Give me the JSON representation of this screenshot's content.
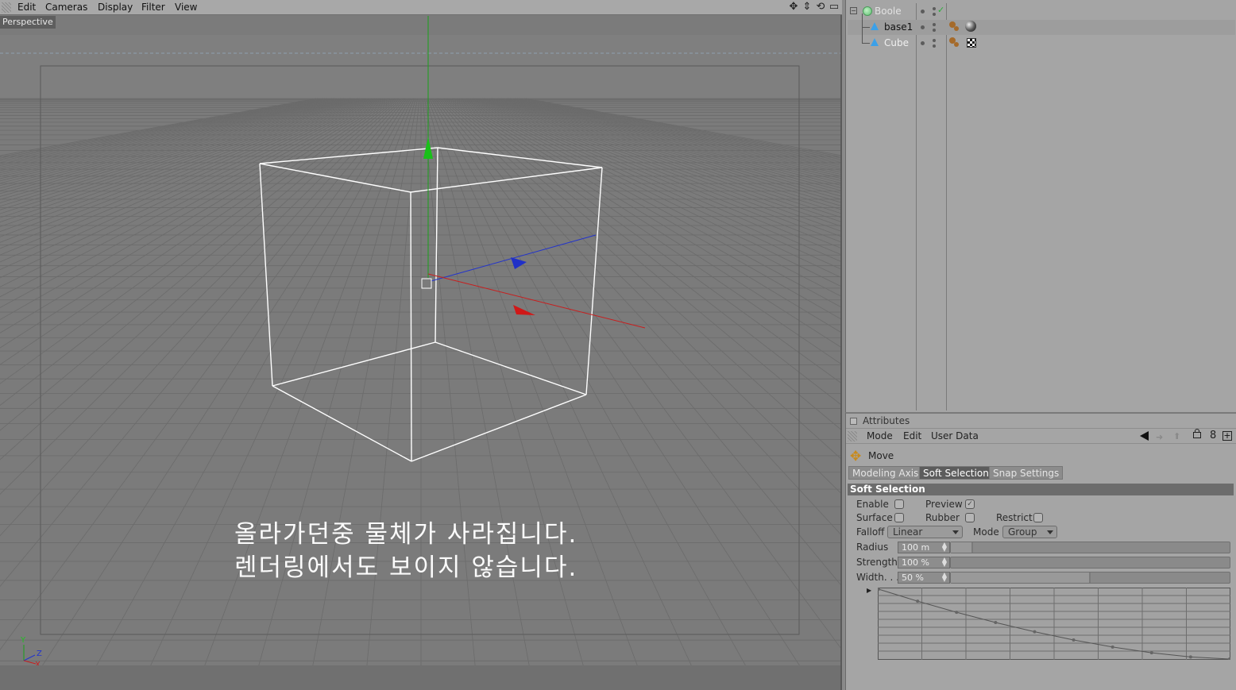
{
  "viewport": {
    "menu": [
      "Edit",
      "Cameras",
      "Display",
      "Filter",
      "View"
    ],
    "camera_label": "Perspective",
    "nav_icons": [
      "move-view-icon",
      "dolly-view-icon",
      "rotate-view-icon",
      "maximize-view-icon"
    ],
    "axis_labels": {
      "y": "Y",
      "z": "Z",
      "x": "X"
    },
    "caption_line1": "올라가던중 물체가 사라집니다.",
    "caption_line2": "렌더링에서도 보이지 않습니다."
  },
  "object_manager": {
    "objects": [
      {
        "name": "Boole",
        "icon": "boole-icon",
        "dimmed": true,
        "check": "✓"
      },
      {
        "name": "base1",
        "icon": "polygon-object-icon",
        "tags": [
          "texture-tag",
          "sphere-material"
        ]
      },
      {
        "name": "Cube",
        "icon": "polygon-object-icon",
        "tags": [
          "texture-tag",
          "checker-material"
        ]
      }
    ]
  },
  "attributes": {
    "title": "Attributes",
    "menu": [
      "Mode",
      "Edit",
      "User Data"
    ],
    "tool_name": "Move",
    "tabs": [
      "Modeling Axis",
      "Soft Selection",
      "Snap Settings"
    ],
    "active_tab": "Soft Selection",
    "section": "Soft Selection",
    "enable_label": "Enable",
    "preview_label": "Preview",
    "surface_label": "Surface",
    "rubber_label": "Rubber",
    "restrict_label": "Restrict",
    "falloff_label": "Falloff",
    "falloff_value": "Linear",
    "mode_label": "Mode",
    "mode_value": "Group",
    "radius_label": "Radius",
    "radius_value": "100 m",
    "radius_level": 0.08,
    "strength_label": "Strength",
    "strength_value": "100 %",
    "strength_level": 0.0,
    "width_label": "Width. . .",
    "width_value": "50 %",
    "width_level": 0.5
  }
}
